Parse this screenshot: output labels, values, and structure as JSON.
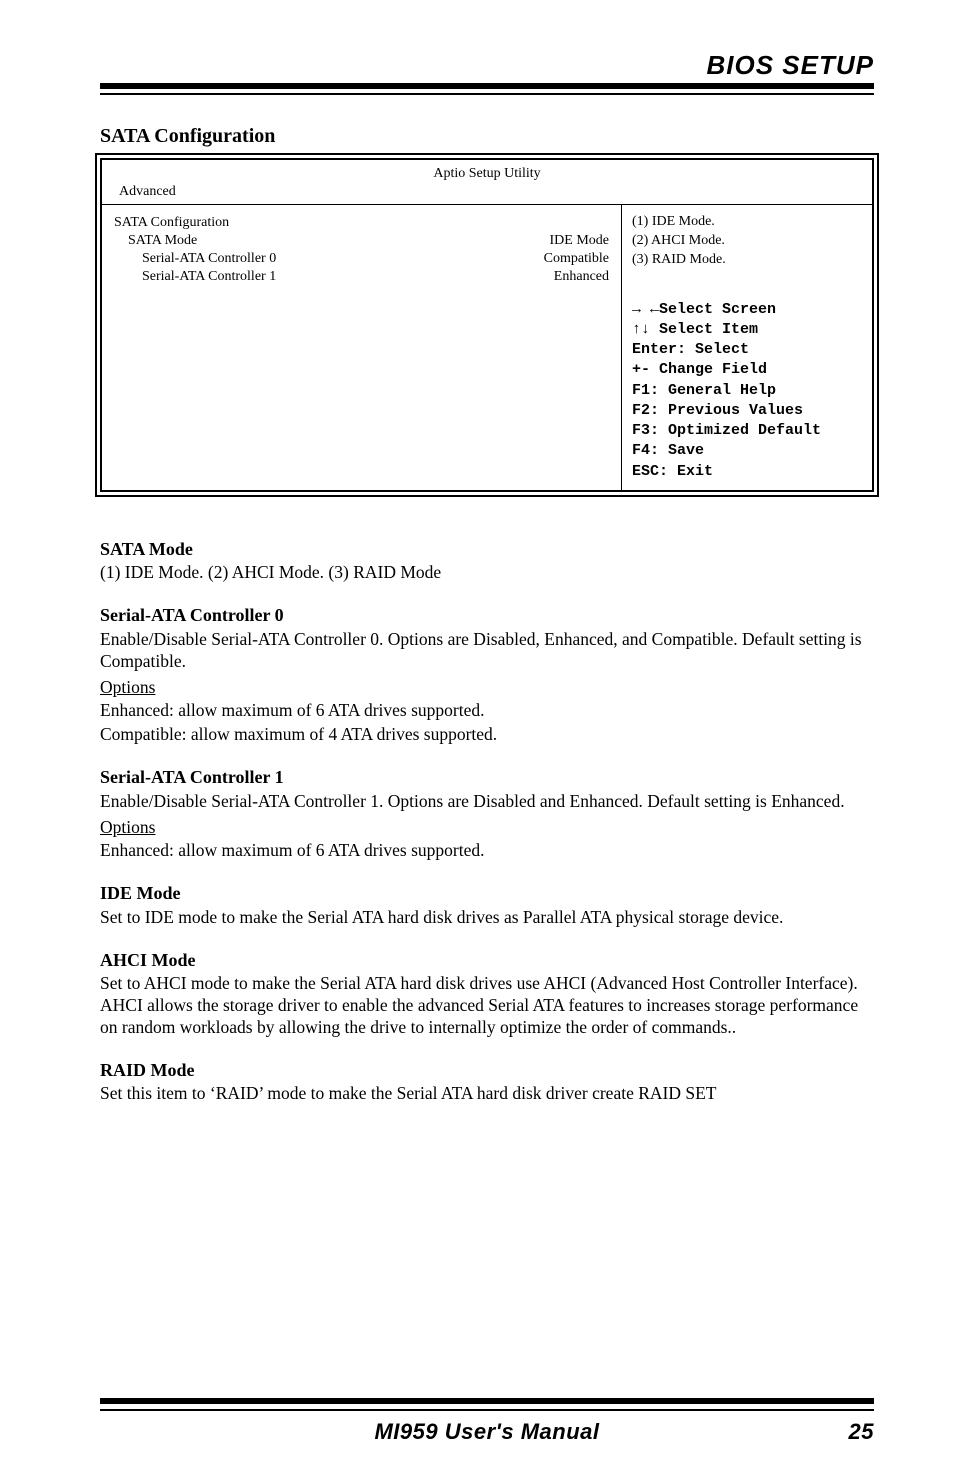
{
  "header": {
    "title": "BIOS SETUP"
  },
  "section_title": "SATA Configuration",
  "bios": {
    "title": "Aptio Setup Utility",
    "tabs": "Advanced",
    "left": {
      "group_label": "SATA Configuration",
      "rows": [
        {
          "label": "SATA Mode",
          "value": "IDE Mode"
        },
        {
          "label": "Serial-ATA Controller 0",
          "value": "Compatible",
          "sub": true
        },
        {
          "label": "Serial-ATA Controller 1",
          "value": "Enhanced",
          "sub": true
        }
      ]
    },
    "right": {
      "desc_lines": [
        "(1) IDE Mode.",
        "(2) AHCI Mode.",
        "(3) RAID Mode."
      ],
      "help": {
        "select_screen": "Select Screen",
        "select_item": "Select Item",
        "enter": "Enter: Select",
        "change": "+-  Change Field",
        "f1": "F1: General Help",
        "f2": "F2: Previous Values",
        "f3": "F3: Optimized Default",
        "f4": "F4: Save",
        "esc": "ESC: Exit"
      }
    }
  },
  "body": {
    "s1": {
      "head": "SATA Mode",
      "text": "(1) IDE Mode. (2) AHCI Mode. (3) RAID Mode"
    },
    "s2": {
      "head": "Serial-ATA Controller 0",
      "p1": "Enable/Disable Serial-ATA Controller 0. Options are Disabled, Enhanced, and Compatible. Default setting is Compatible.",
      "opthead": "Options",
      "o1": "Enhanced: allow maximum of 6 ATA drives supported.",
      "o2": "Compatible: allow maximum of 4 ATA drives supported."
    },
    "s3": {
      "head": "Serial-ATA Controller 1",
      "p1": "Enable/Disable Serial-ATA Controller 1. Options are Disabled and Enhanced. Default setting is Enhanced.",
      "opthead": "Options",
      "o1": "Enhanced: allow maximum of 6 ATA drives supported."
    },
    "s4": {
      "head": "IDE Mode",
      "p1": "Set to IDE mode to make the Serial ATA hard disk drives as Parallel ATA physical storage device."
    },
    "s5": {
      "head": "AHCI Mode",
      "p1": "Set to AHCI mode to make the Serial ATA hard disk drives use AHCI (Advanced Host Controller Interface). AHCI allows the storage driver to enable the advanced Serial ATA features to increases storage performance on random workloads by allowing the drive to internally optimize the order of commands.."
    },
    "s6": {
      "head": "RAID Mode",
      "p1": "Set this item to ‘RAID’ mode to make the Serial ATA hard disk driver create RAID SET"
    }
  },
  "footer": {
    "title": "MI959 User's Manual",
    "page": "25"
  }
}
